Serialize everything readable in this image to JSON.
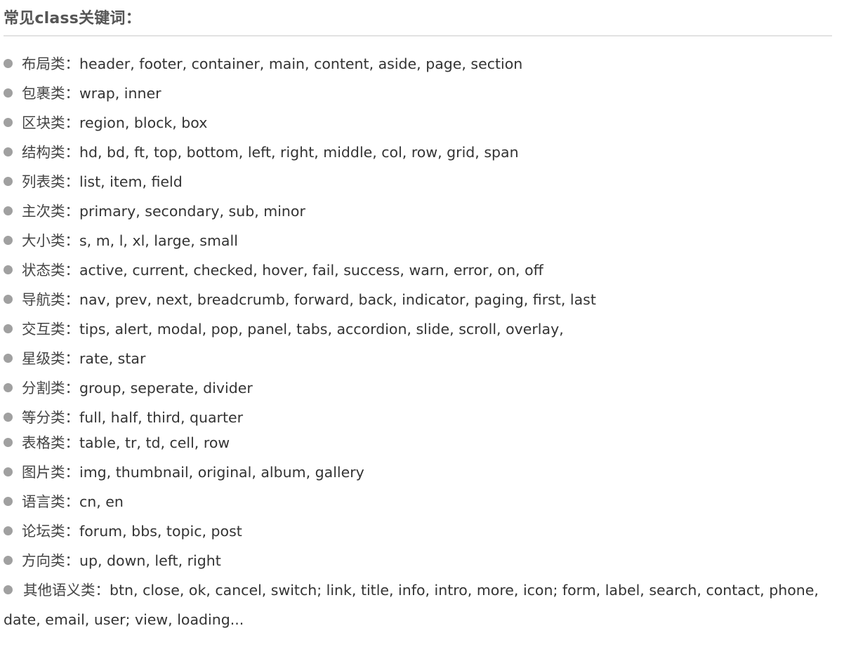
{
  "title": "常见class关键词：",
  "colon": "：",
  "items": [
    {
      "category": "布局类",
      "values": "header, footer, container, main, content, aside, page, section"
    },
    {
      "category": "包裹类",
      "values": "wrap, inner"
    },
    {
      "category": "区块类",
      "values": "region, block, box"
    },
    {
      "category": "结构类",
      "values": "hd, bd, ft, top, bottom, left, right, middle, col, row, grid, span"
    },
    {
      "category": "列表类",
      "values": "list, item, field"
    },
    {
      "category": "主次类",
      "values": "primary, secondary, sub, minor"
    },
    {
      "category": "大小类",
      "values": "s, m, l, xl, large, small"
    },
    {
      "category": "状态类",
      "values": "active, current, checked, hover, fail, success, warn, error, on, off"
    },
    {
      "category": "导航类",
      "values": "nav, prev, next, breadcrumb, forward, back, indicator, paging, first, last"
    },
    {
      "category": "交互类",
      "values": "tips, alert, modal, pop, panel, tabs, accordion, slide, scroll, overlay,"
    },
    {
      "category": "星级类",
      "values": "rate, star"
    },
    {
      "category": "分割类",
      "values": "group, seperate, divider"
    },
    {
      "category": "等分类",
      "values": "full, half, third, quarter"
    },
    {
      "category": "表格类",
      "values": "table, tr, td, cell, row"
    },
    {
      "category": "图片类",
      "values": "img, thumbnail, original, album, gallery"
    },
    {
      "category": "语言类",
      "values": "cn, en"
    },
    {
      "category": "论坛类",
      "values": "forum, bbs, topic, post"
    },
    {
      "category": "方向类",
      "values": "up, down, left, right"
    },
    {
      "category": "其他语义类",
      "values": "btn, close, ok, cancel, switch; link, title, info, intro, more, icon; form, label, search, contact, phone, date, email, user; view, loading..."
    }
  ]
}
